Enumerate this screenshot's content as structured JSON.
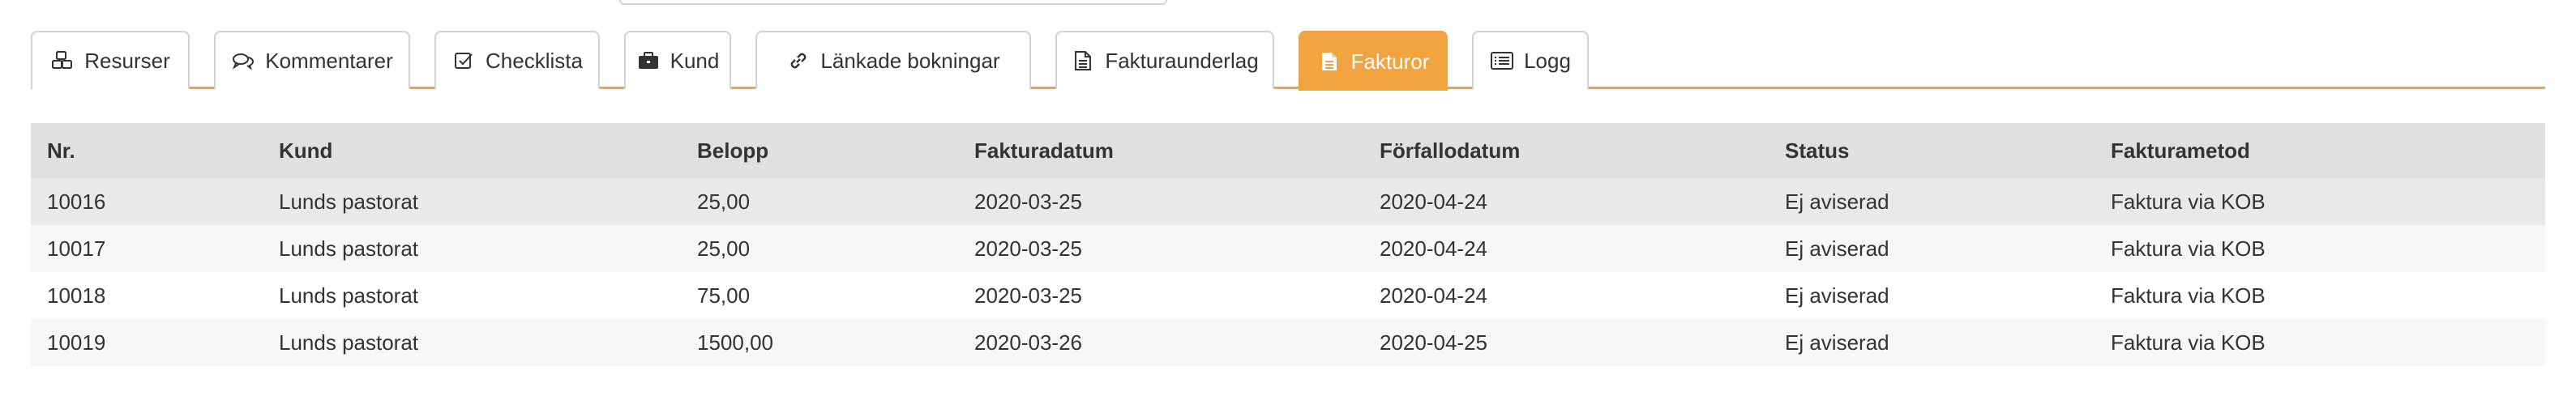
{
  "tabs": [
    {
      "label": "Resurser",
      "icon": "cubes-icon",
      "active": false
    },
    {
      "label": "Kommentarer",
      "icon": "comments-icon",
      "active": false
    },
    {
      "label": "Checklista",
      "icon": "checkbox-icon",
      "active": false
    },
    {
      "label": "Kund",
      "icon": "briefcase-icon",
      "active": false
    },
    {
      "label": "Länkade bokningar",
      "icon": "link-icon",
      "active": false
    },
    {
      "label": "Fakturaunderlag",
      "icon": "document-icon",
      "active": false
    },
    {
      "label": "Fakturor",
      "icon": "document-filled-icon",
      "active": true
    },
    {
      "label": "Logg",
      "icon": "list-icon",
      "active": false
    }
  ],
  "colors": {
    "accent": "#f0a33e",
    "header_bg": "#e0e0e0"
  },
  "table": {
    "headers": [
      "Nr.",
      "Kund",
      "Belopp",
      "Fakturadatum",
      "Förfallodatum",
      "Status",
      "Fakturametod"
    ],
    "rows": [
      [
        "10016",
        "Lunds pastorat",
        "25,00",
        "2020-03-25",
        "2020-04-24",
        "Ej aviserad",
        "Faktura via KOB"
      ],
      [
        "10017",
        "Lunds pastorat",
        "25,00",
        "2020-03-25",
        "2020-04-24",
        "Ej aviserad",
        "Faktura via KOB"
      ],
      [
        "10018",
        "Lunds pastorat",
        "75,00",
        "2020-03-25",
        "2020-04-24",
        "Ej aviserad",
        "Faktura via KOB"
      ],
      [
        "10019",
        "Lunds pastorat",
        "1500,00",
        "2020-03-26",
        "2020-04-25",
        "Ej aviserad",
        "Faktura via KOB"
      ]
    ]
  }
}
